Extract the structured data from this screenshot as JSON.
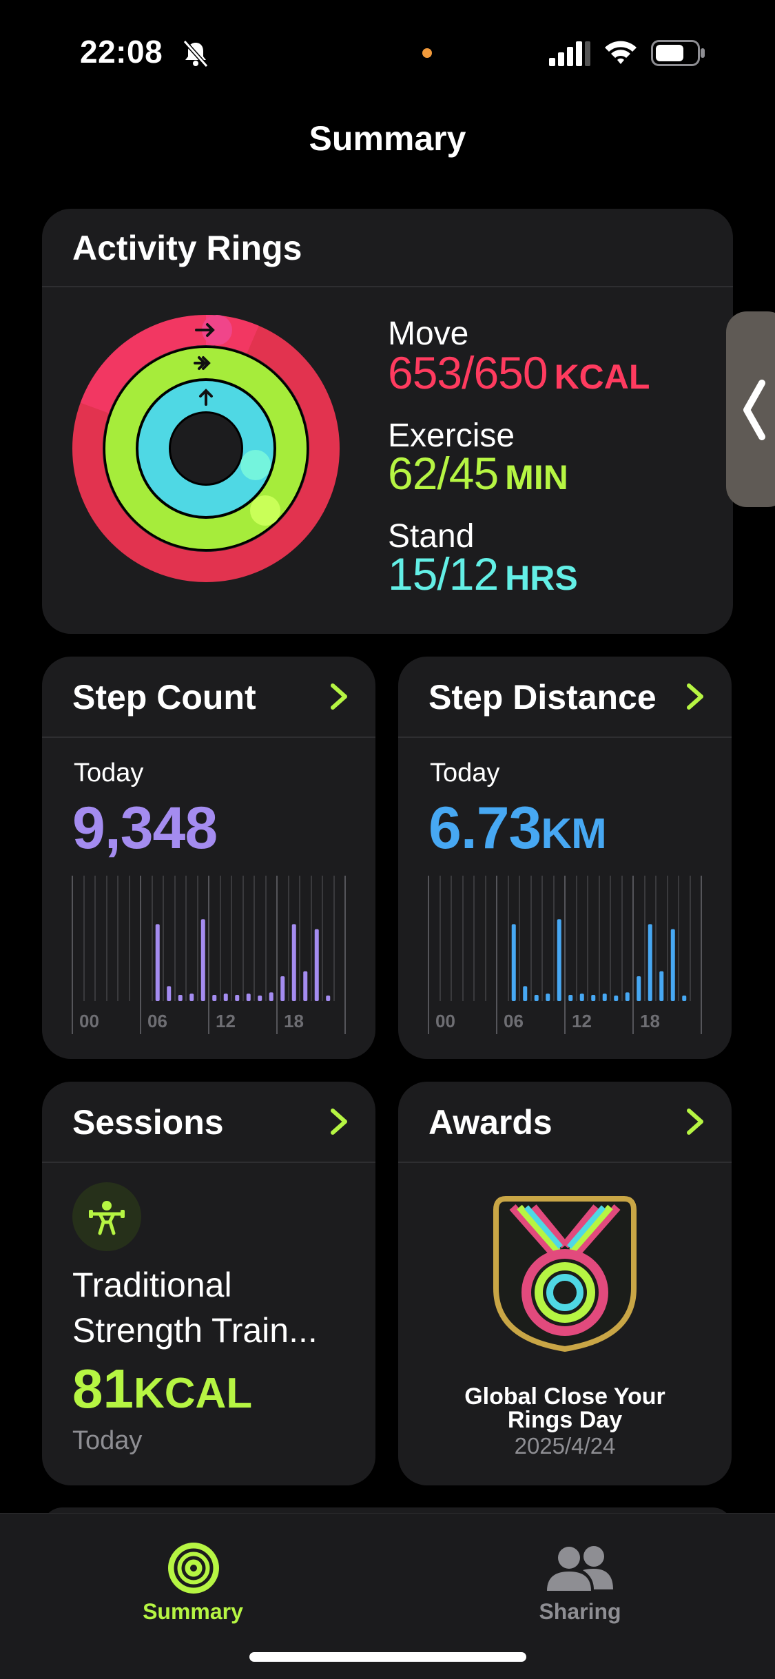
{
  "status_bar": {
    "time": "22:08"
  },
  "page_title": "Summary",
  "activity": {
    "title": "Activity Rings",
    "move": {
      "label": "Move",
      "value": "653/650",
      "unit": "KCAL",
      "color": "#ff3b5f",
      "fraction": 1.0
    },
    "exercise": {
      "label": "Exercise",
      "value": "62/45",
      "unit": "MIN",
      "color": "#b6f543",
      "fraction": 1.38
    },
    "stand": {
      "label": "Stand",
      "value": "15/12",
      "unit": "HRS",
      "color": "#63efe6",
      "fraction": 1.25
    }
  },
  "step_count": {
    "title": "Step Count",
    "today_label": "Today",
    "value": "9,348",
    "color": "#a48cf0",
    "x_ticks": [
      "00",
      "06",
      "12",
      "18"
    ]
  },
  "step_distance": {
    "title": "Step Distance",
    "today_label": "Today",
    "value": "6.73",
    "unit": "KM",
    "color": "#47a8f3",
    "x_ticks": [
      "00",
      "06",
      "12",
      "18"
    ]
  },
  "sessions": {
    "title": "Sessions",
    "workout_name": "Traditional Strength Train...",
    "value": "81",
    "unit": "KCAL",
    "date": "Today",
    "icon": "strength-training-icon"
  },
  "awards": {
    "title": "Awards",
    "award_name": "Global Close Your Rings Day",
    "award_date": "2025/4/24"
  },
  "tabs": [
    {
      "label": "Summary",
      "icon": "activity-rings-icon",
      "active": true
    },
    {
      "label": "Sharing",
      "icon": "people-icon",
      "active": false
    }
  ],
  "colors": {
    "accent": "#b6f543",
    "card": "#1c1c1e"
  }
}
